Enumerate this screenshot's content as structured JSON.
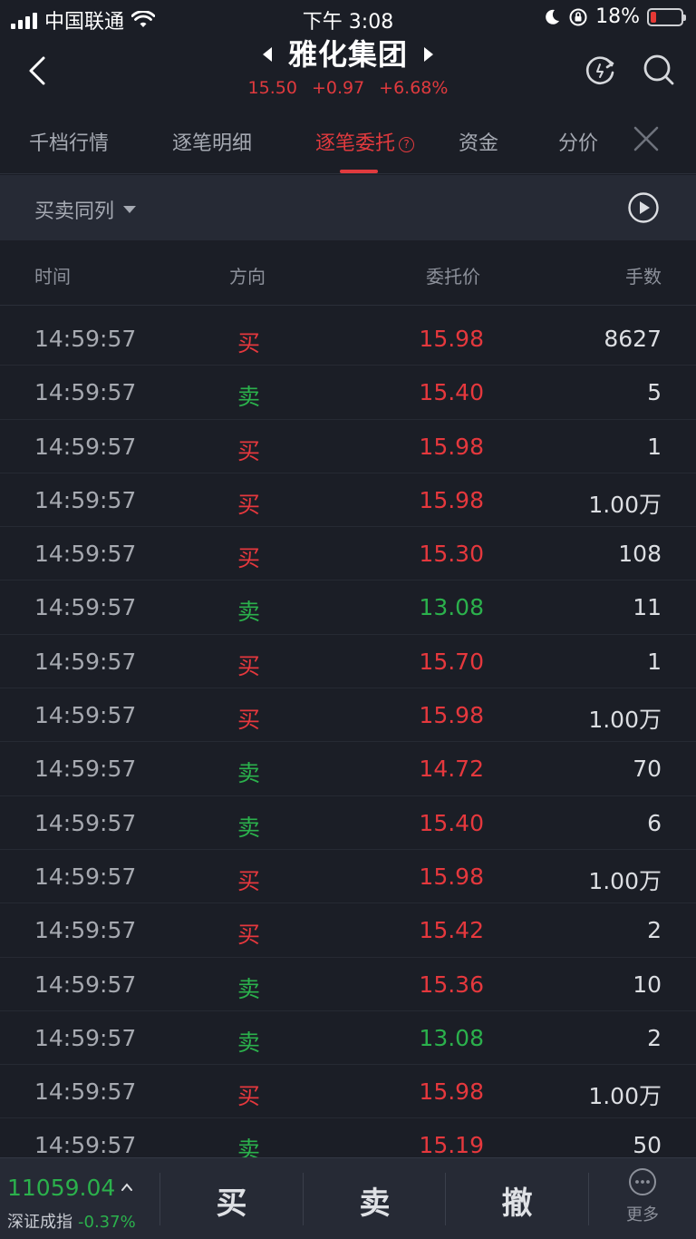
{
  "status_bar": {
    "carrier": "中国联通",
    "time": "下午 3:08",
    "battery": "18%",
    "battery_level": 0.18
  },
  "header": {
    "title": "雅化集团",
    "price": "15.50",
    "change": "+0.97",
    "change_pct": "+6.68%"
  },
  "tabs": [
    {
      "label": "千档行情"
    },
    {
      "label": "逐笔明细"
    },
    {
      "label": "逐笔委托"
    },
    {
      "label": "资金"
    },
    {
      "label": "分价"
    }
  ],
  "help_mark": "?",
  "filter": {
    "label": "买卖同列"
  },
  "table": {
    "columns": [
      "时间",
      "方向",
      "委托价",
      "手数"
    ],
    "rows": [
      {
        "time": "14:59:57",
        "dir": "买",
        "price": "15.98",
        "vol": "8627",
        "dir_color": "red",
        "price_color": "red"
      },
      {
        "time": "14:59:57",
        "dir": "卖",
        "price": "15.40",
        "vol": "5",
        "dir_color": "green",
        "price_color": "red"
      },
      {
        "time": "14:59:57",
        "dir": "买",
        "price": "15.98",
        "vol": "1",
        "dir_color": "red",
        "price_color": "red"
      },
      {
        "time": "14:59:57",
        "dir": "买",
        "price": "15.98",
        "vol": "1.00万",
        "dir_color": "red",
        "price_color": "red"
      },
      {
        "time": "14:59:57",
        "dir": "买",
        "price": "15.30",
        "vol": "108",
        "dir_color": "red",
        "price_color": "red"
      },
      {
        "time": "14:59:57",
        "dir": "卖",
        "price": "13.08",
        "vol": "11",
        "dir_color": "green",
        "price_color": "green"
      },
      {
        "time": "14:59:57",
        "dir": "买",
        "price": "15.70",
        "vol": "1",
        "dir_color": "red",
        "price_color": "red"
      },
      {
        "time": "14:59:57",
        "dir": "买",
        "price": "15.98",
        "vol": "1.00万",
        "dir_color": "red",
        "price_color": "red"
      },
      {
        "time": "14:59:57",
        "dir": "卖",
        "price": "14.72",
        "vol": "70",
        "dir_color": "green",
        "price_color": "red"
      },
      {
        "time": "14:59:57",
        "dir": "卖",
        "price": "15.40",
        "vol": "6",
        "dir_color": "green",
        "price_color": "red"
      },
      {
        "time": "14:59:57",
        "dir": "买",
        "price": "15.98",
        "vol": "1.00万",
        "dir_color": "red",
        "price_color": "red"
      },
      {
        "time": "14:59:57",
        "dir": "买",
        "price": "15.42",
        "vol": "2",
        "dir_color": "red",
        "price_color": "red"
      },
      {
        "time": "14:59:57",
        "dir": "卖",
        "price": "15.36",
        "vol": "10",
        "dir_color": "green",
        "price_color": "red"
      },
      {
        "time": "14:59:57",
        "dir": "卖",
        "price": "13.08",
        "vol": "2",
        "dir_color": "green",
        "price_color": "green"
      },
      {
        "time": "14:59:57",
        "dir": "买",
        "price": "15.98",
        "vol": "1.00万",
        "dir_color": "red",
        "price_color": "red"
      },
      {
        "time": "14:59:57",
        "dir": "卖",
        "price": "15.19",
        "vol": "50",
        "dir_color": "green",
        "price_color": "red"
      }
    ]
  },
  "bottom": {
    "index_value": "11059.04",
    "index_name": "深证成指",
    "index_change": "-0.37%",
    "buy": "买",
    "sell": "卖",
    "cancel": "撤",
    "more": "更多"
  },
  "colors": {
    "up_red": "#e5383d",
    "down_green": "#2bb14c",
    "background": "#1b1e26",
    "panel": "#262a35"
  }
}
